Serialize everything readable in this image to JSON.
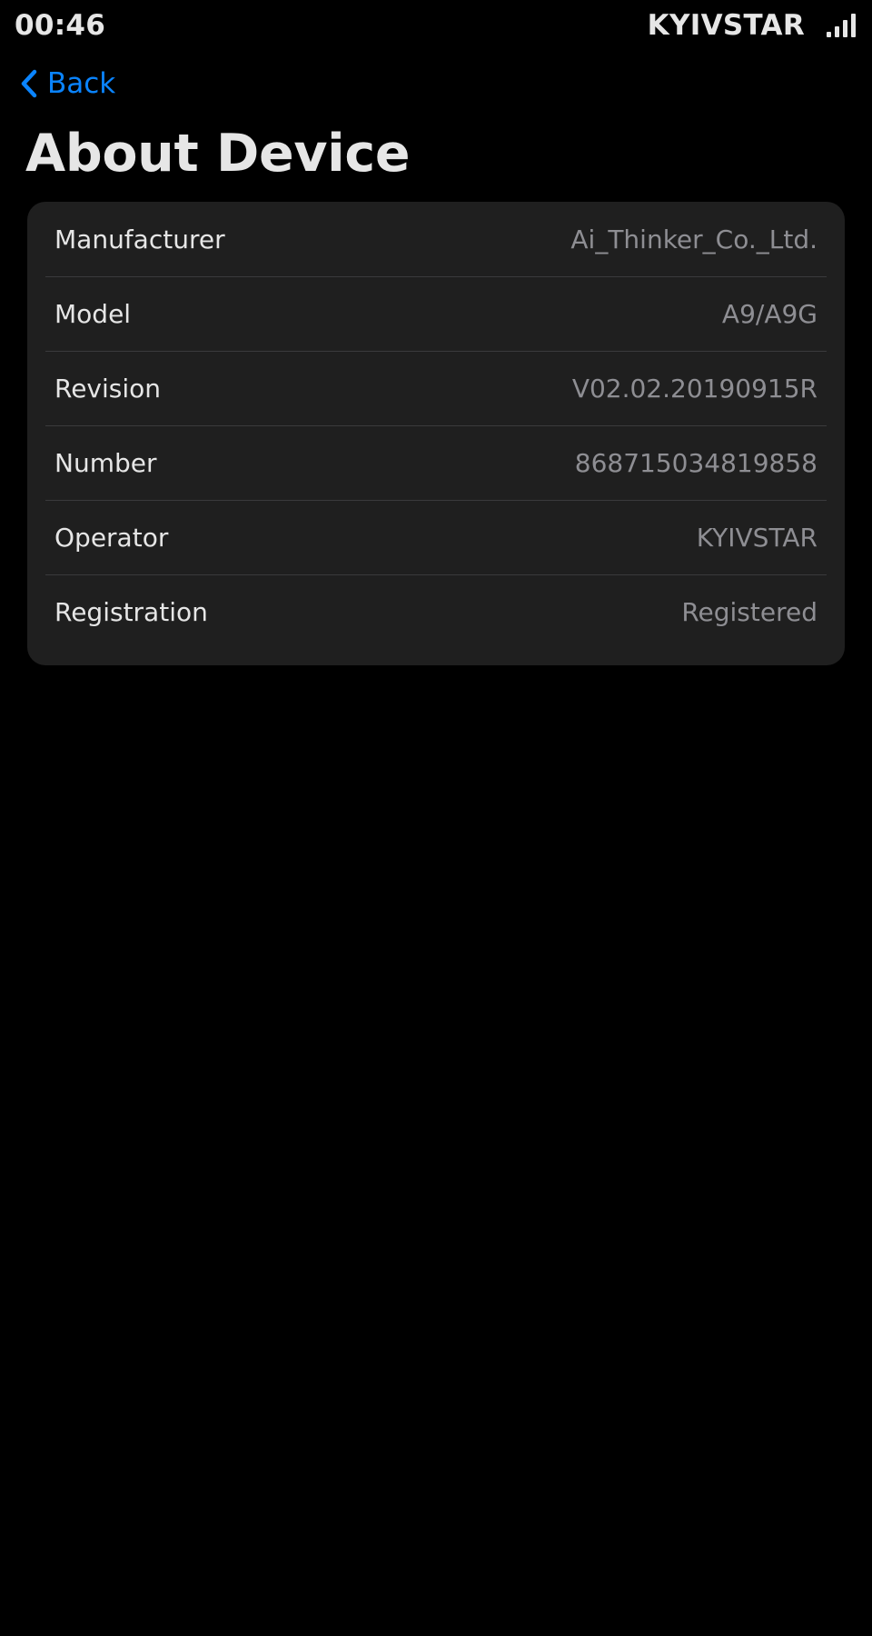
{
  "status_bar": {
    "time": "00:46",
    "carrier": "KYIVSTAR",
    "signal_icon": "signal-bars-icon"
  },
  "nav": {
    "back_label": "Back",
    "back_icon": "chevron-left-icon"
  },
  "page": {
    "title": "About Device"
  },
  "colors": {
    "background": "#000000",
    "card": "#1f1f1f",
    "accent": "#0a84ff",
    "primary_text": "#e6e6e6",
    "secondary_text": "#8e8e93",
    "separator": "#3a3a3c"
  },
  "device_info": {
    "rows": [
      {
        "label": "Manufacturer",
        "value": "Ai_Thinker_Co._Ltd."
      },
      {
        "label": "Model",
        "value": "A9/A9G"
      },
      {
        "label": "Revision",
        "value": "V02.02.20190915R"
      },
      {
        "label": "Number",
        "value": "868715034819858"
      },
      {
        "label": "Operator",
        "value": "KYIVSTAR"
      },
      {
        "label": "Registration",
        "value": "Registered"
      }
    ]
  }
}
